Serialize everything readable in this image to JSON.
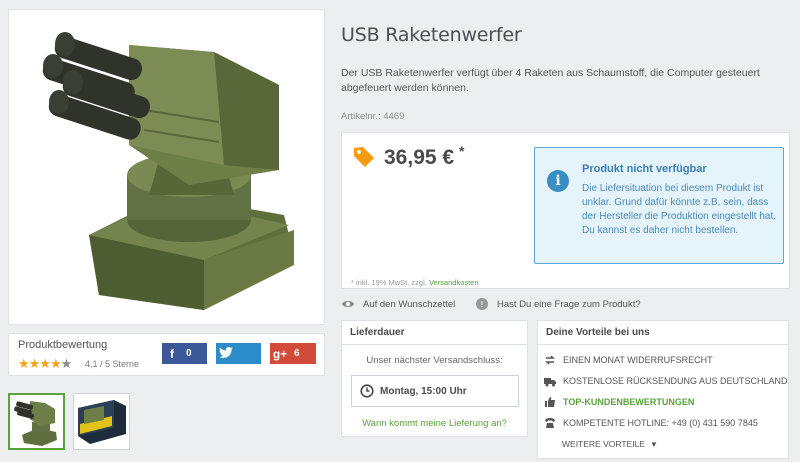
{
  "product": {
    "title": "USB Raketenwerfer",
    "description": "Der USB Raketenwerfer verfügt über 4 Raketen aus Schaumstoff, die Computer gesteuert abgefeuert werden können.",
    "article_number": "Artikelnr.: 4469",
    "price": "36,95 €",
    "price_star": "*",
    "vat_note": "* inkl. 19% MwSt. zzgl.",
    "shipping_link": "Versandkosten"
  },
  "alert": {
    "icon": "info-icon",
    "title": "Produkt nicht verfügbar",
    "text": "Die Liefersituation bei diesem Produkt ist unklar. Grund dafür könnte z.B. sein, dass der Hersteller die Produktion eingestellt hat. Du kannst es daher nicht bestellen."
  },
  "rating": {
    "title": "Produktbewertung",
    "value": 4.1,
    "text": "4,1 / 5 Sterne"
  },
  "social": {
    "facebook_count": "0",
    "google_count": "6"
  },
  "actions": {
    "wishlist": "Auf den Wunschzettel",
    "question": "Hast Du eine Frage zum Produkt?"
  },
  "delivery": {
    "title": "Lieferdauer",
    "label": "Unser nächster Versandschluss:",
    "time": "Montag, 15:00 Uhr",
    "link": "Wann kommt meine Lieferung an?"
  },
  "advantages": {
    "title": "Deine Vorteile bei uns",
    "items": [
      {
        "icon": "exchange-icon",
        "label": "Einen Monat Widerrufsrecht"
      },
      {
        "icon": "truck-icon",
        "label": "Kostenlose Rücksendung aus Deutschland"
      },
      {
        "icon": "thumbs-up-icon",
        "label": "Top-Kundenbewertungen"
      },
      {
        "icon": "phone-icon",
        "label": "Kompetente Hotline: +49 (0) 431 590 7845"
      }
    ],
    "more": "Weitere Vorteile"
  },
  "colors": {
    "accent_green": "#5aa23c",
    "price_tag_orange": "#f39c12",
    "alert_blue": "#3b8dc5"
  }
}
